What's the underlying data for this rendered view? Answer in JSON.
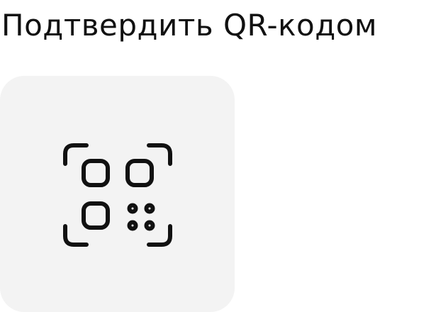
{
  "header": {
    "title": "Подтвердить  QR-кодом"
  },
  "qr_tile": {
    "icon": "qr-code-scan-icon",
    "background_color": "#f3f3f3",
    "icon_color": "#111111"
  }
}
